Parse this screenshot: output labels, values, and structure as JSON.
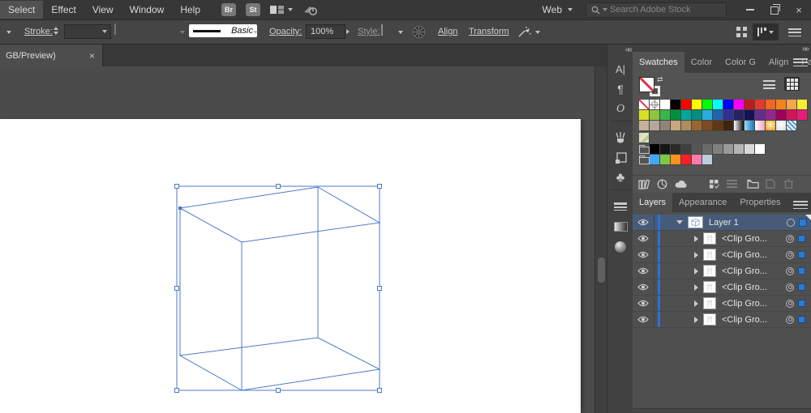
{
  "menubar": {
    "items": [
      "Select",
      "Effect",
      "View",
      "Window",
      "Help"
    ],
    "bridge_button": "Br",
    "stock_button": "St",
    "workspace_switcher": "Web",
    "search_placeholder": "Search Adobe Stock",
    "close_button": "×"
  },
  "controlbar": {
    "stroke_label": "Stroke:",
    "brush_definition": "Basic",
    "opacity_label": "Opacity:",
    "opacity_value": "100%",
    "style_label": "Style:",
    "align_link": "Align",
    "transform_link": "Transform"
  },
  "document_tab": {
    "title": "GB/Preview)",
    "close": "×"
  },
  "panel_group_top": {
    "tabs": [
      "Swatches",
      "Color",
      "Color G",
      "Align",
      "Pathfi"
    ],
    "active": 0
  },
  "panel_group_layers": {
    "tabs": [
      "Layers",
      "Appearance",
      "Properties"
    ],
    "active": 0
  },
  "layers": {
    "root_name": "Layer 1",
    "children": [
      "<Clip Gro...",
      "<Clip Gro...",
      "<Clip Gro...",
      "<Clip Gro...",
      "<Clip Gro...",
      "<Clip Gro..."
    ]
  },
  "swatches": {
    "row1": [
      "none",
      "reg",
      "#ffffff",
      "#000000",
      "#ff0000",
      "#ffff00",
      "#00ff00",
      "#00ffff",
      "#0000ff",
      "#ff00ff",
      "#ba1c21",
      "#e23a2e",
      "#f26522",
      "#f58220",
      "#f9a64a",
      "#f9ed32"
    ],
    "row2": [
      "#d9e021",
      "#8cc63f",
      "#3ab54a",
      "#00913f",
      "#00a79d",
      "#008f7e",
      "#29abe2",
      "#2064af",
      "#2e3192",
      "#252365",
      "#151153",
      "#662d91",
      "#91278f",
      "#9e005d",
      "#d4145a",
      "#ed197b"
    ],
    "row3": [
      "#c7b299",
      "#b5a898",
      "#8f8578",
      "#c8a77f",
      "#b08d5f",
      "#96682e",
      "#7b4b21",
      "#5e3813",
      "#3f2410",
      "lg:#ffffff,#0d0d0d",
      "lg:#9addf5,#1b75bb",
      "lg:#ffffff,#f5a3c7",
      "rg:#fff8b0,#f7941d",
      "rg:#ffffff,#dcdcdc",
      "pat:pin"
    ],
    "pattern_row": [
      "pat:map"
    ],
    "grays": [
      "#000000",
      "#161616",
      "#2b2b2b",
      "#404040",
      "#565656",
      "#6b6b6b",
      "#808080",
      "#9a9a9a",
      "#b5b5b5",
      "#d9d9d9",
      "#ffffff"
    ],
    "brights": [
      "#3fa9f5",
      "#7ac943",
      "#ff931e",
      "#ff1d25",
      "#ff7bac",
      "#b9cfdc"
    ]
  },
  "colors": {
    "selection_blue": "#4d79c7",
    "layer_selected_bg": "#475b78",
    "layer_color_bar": "#2e6fd9",
    "layer_indicator_square": "#2f7ad1"
  }
}
